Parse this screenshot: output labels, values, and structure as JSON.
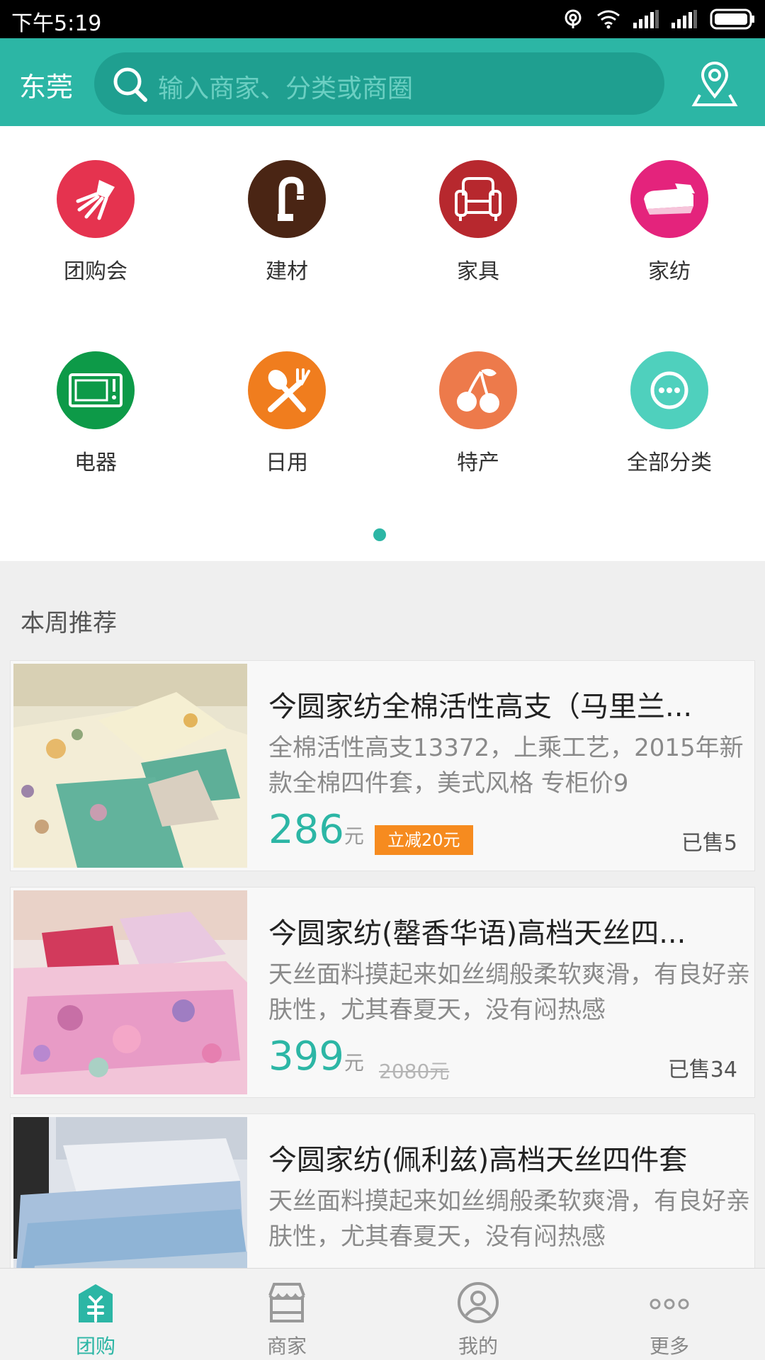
{
  "status_bar": {
    "time": "下午5:19",
    "icons": [
      "hotspot-icon",
      "wifi-icon",
      "signal-icon",
      "signal-icon",
      "battery-icon"
    ]
  },
  "header": {
    "city": "东莞",
    "search_placeholder": "输入商家、分类或商圈",
    "location_icon": "location-pin-icon",
    "accent_color": "#2cb6a5"
  },
  "categories": [
    {
      "label": "团购会",
      "icon": "squid-icon",
      "color": "#e5334f"
    },
    {
      "label": "建材",
      "icon": "faucet-icon",
      "color": "#4a2514"
    },
    {
      "label": "家具",
      "icon": "armchair-icon",
      "color": "#b7282e"
    },
    {
      "label": "家纺",
      "icon": "bedding-icon",
      "color": "#e4237c"
    },
    {
      "label": "电器",
      "icon": "microwave-icon",
      "color": "#0d9a48"
    },
    {
      "label": "日用",
      "icon": "utensils-icon",
      "color": "#f07d1e"
    },
    {
      "label": "特产",
      "icon": "cherry-icon",
      "color": "#ed7a4b"
    },
    {
      "label": "全部分类",
      "icon": "more-dots-icon",
      "color": "#4fd0bd"
    }
  ],
  "section": {
    "title": "本周推荐"
  },
  "products": [
    {
      "title": "今圆家纺全棉活性高支（马里兰...",
      "desc": "全棉活性高支13372，上乘工艺，2015年新款全棉四件套，美式风格 专柜价9",
      "price": "286",
      "unit": "元",
      "tag": "立减20元",
      "sold": "已售5"
    },
    {
      "title": "今圆家纺(罄香华语)高档天丝四...",
      "desc": "天丝面料摸起来如丝绸般柔软爽滑，有良好亲肤性，尤其春夏天，没有闷热感",
      "price": "399",
      "unit": "元",
      "original_price": "2080元",
      "sold": "已售34"
    },
    {
      "title": "今圆家纺(佩利兹)高档天丝四件套",
      "desc": "天丝面料摸起来如丝绸般柔软爽滑，有良好亲肤性，尤其春夏天，没有闷热感",
      "price": "",
      "unit": ""
    }
  ],
  "bottom_nav": [
    {
      "label": "团购",
      "icon": "group-buy-icon",
      "active": true
    },
    {
      "label": "商家",
      "icon": "store-icon",
      "active": false
    },
    {
      "label": "我的",
      "icon": "user-icon",
      "active": false
    },
    {
      "label": "更多",
      "icon": "more-icon",
      "active": false
    }
  ]
}
